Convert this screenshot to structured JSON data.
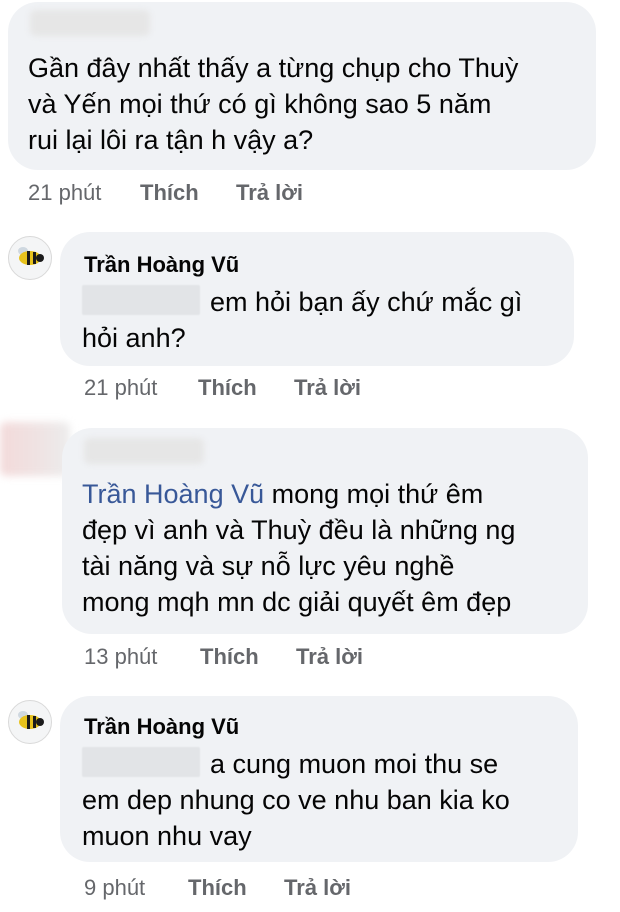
{
  "comments": [
    {
      "id": "c1",
      "author_redacted": true,
      "lines": [
        "Gần đây nhất thấy a từng chụp cho Thuỳ",
        "và Yến mọi thứ  có gì không sao 5 năm",
        "rui lại lôi ra tận h vậy a?"
      ],
      "time": "21 phút",
      "like_label": "Thích",
      "reply_label": "Trả lời"
    },
    {
      "id": "r1",
      "author": "Trần Hoàng Vũ",
      "avatar_icon": "bee-avatar-icon",
      "lines": [
        "em hỏi bạn ấy chứ mắc gì",
        "hỏi anh?"
      ],
      "time": "21 phút",
      "like_label": "Thích",
      "reply_label": "Trả lời"
    },
    {
      "id": "c2",
      "author_redacted": true,
      "mention": "Trần Hoàng Vũ",
      "lines": [
        " mong mọi thứ  êm",
        "đẹp vì anh và Thuỳ đều là những ng",
        "tài năng và sự nỗ lực yêu nghề",
        "mong mqh mn dc giải quyết êm đẹp"
      ],
      "time": "13 phút",
      "like_label": "Thích",
      "reply_label": "Trả lời"
    },
    {
      "id": "r2",
      "author": "Trần Hoàng Vũ",
      "avatar_icon": "bee-avatar-icon",
      "lines": [
        "a cung muon moi thu se",
        "em dep nhung co ve nhu ban kia ko",
        "muon nhu vay"
      ],
      "time": "9 phút",
      "like_label": "Thích",
      "reply_label": "Trả lời"
    }
  ]
}
